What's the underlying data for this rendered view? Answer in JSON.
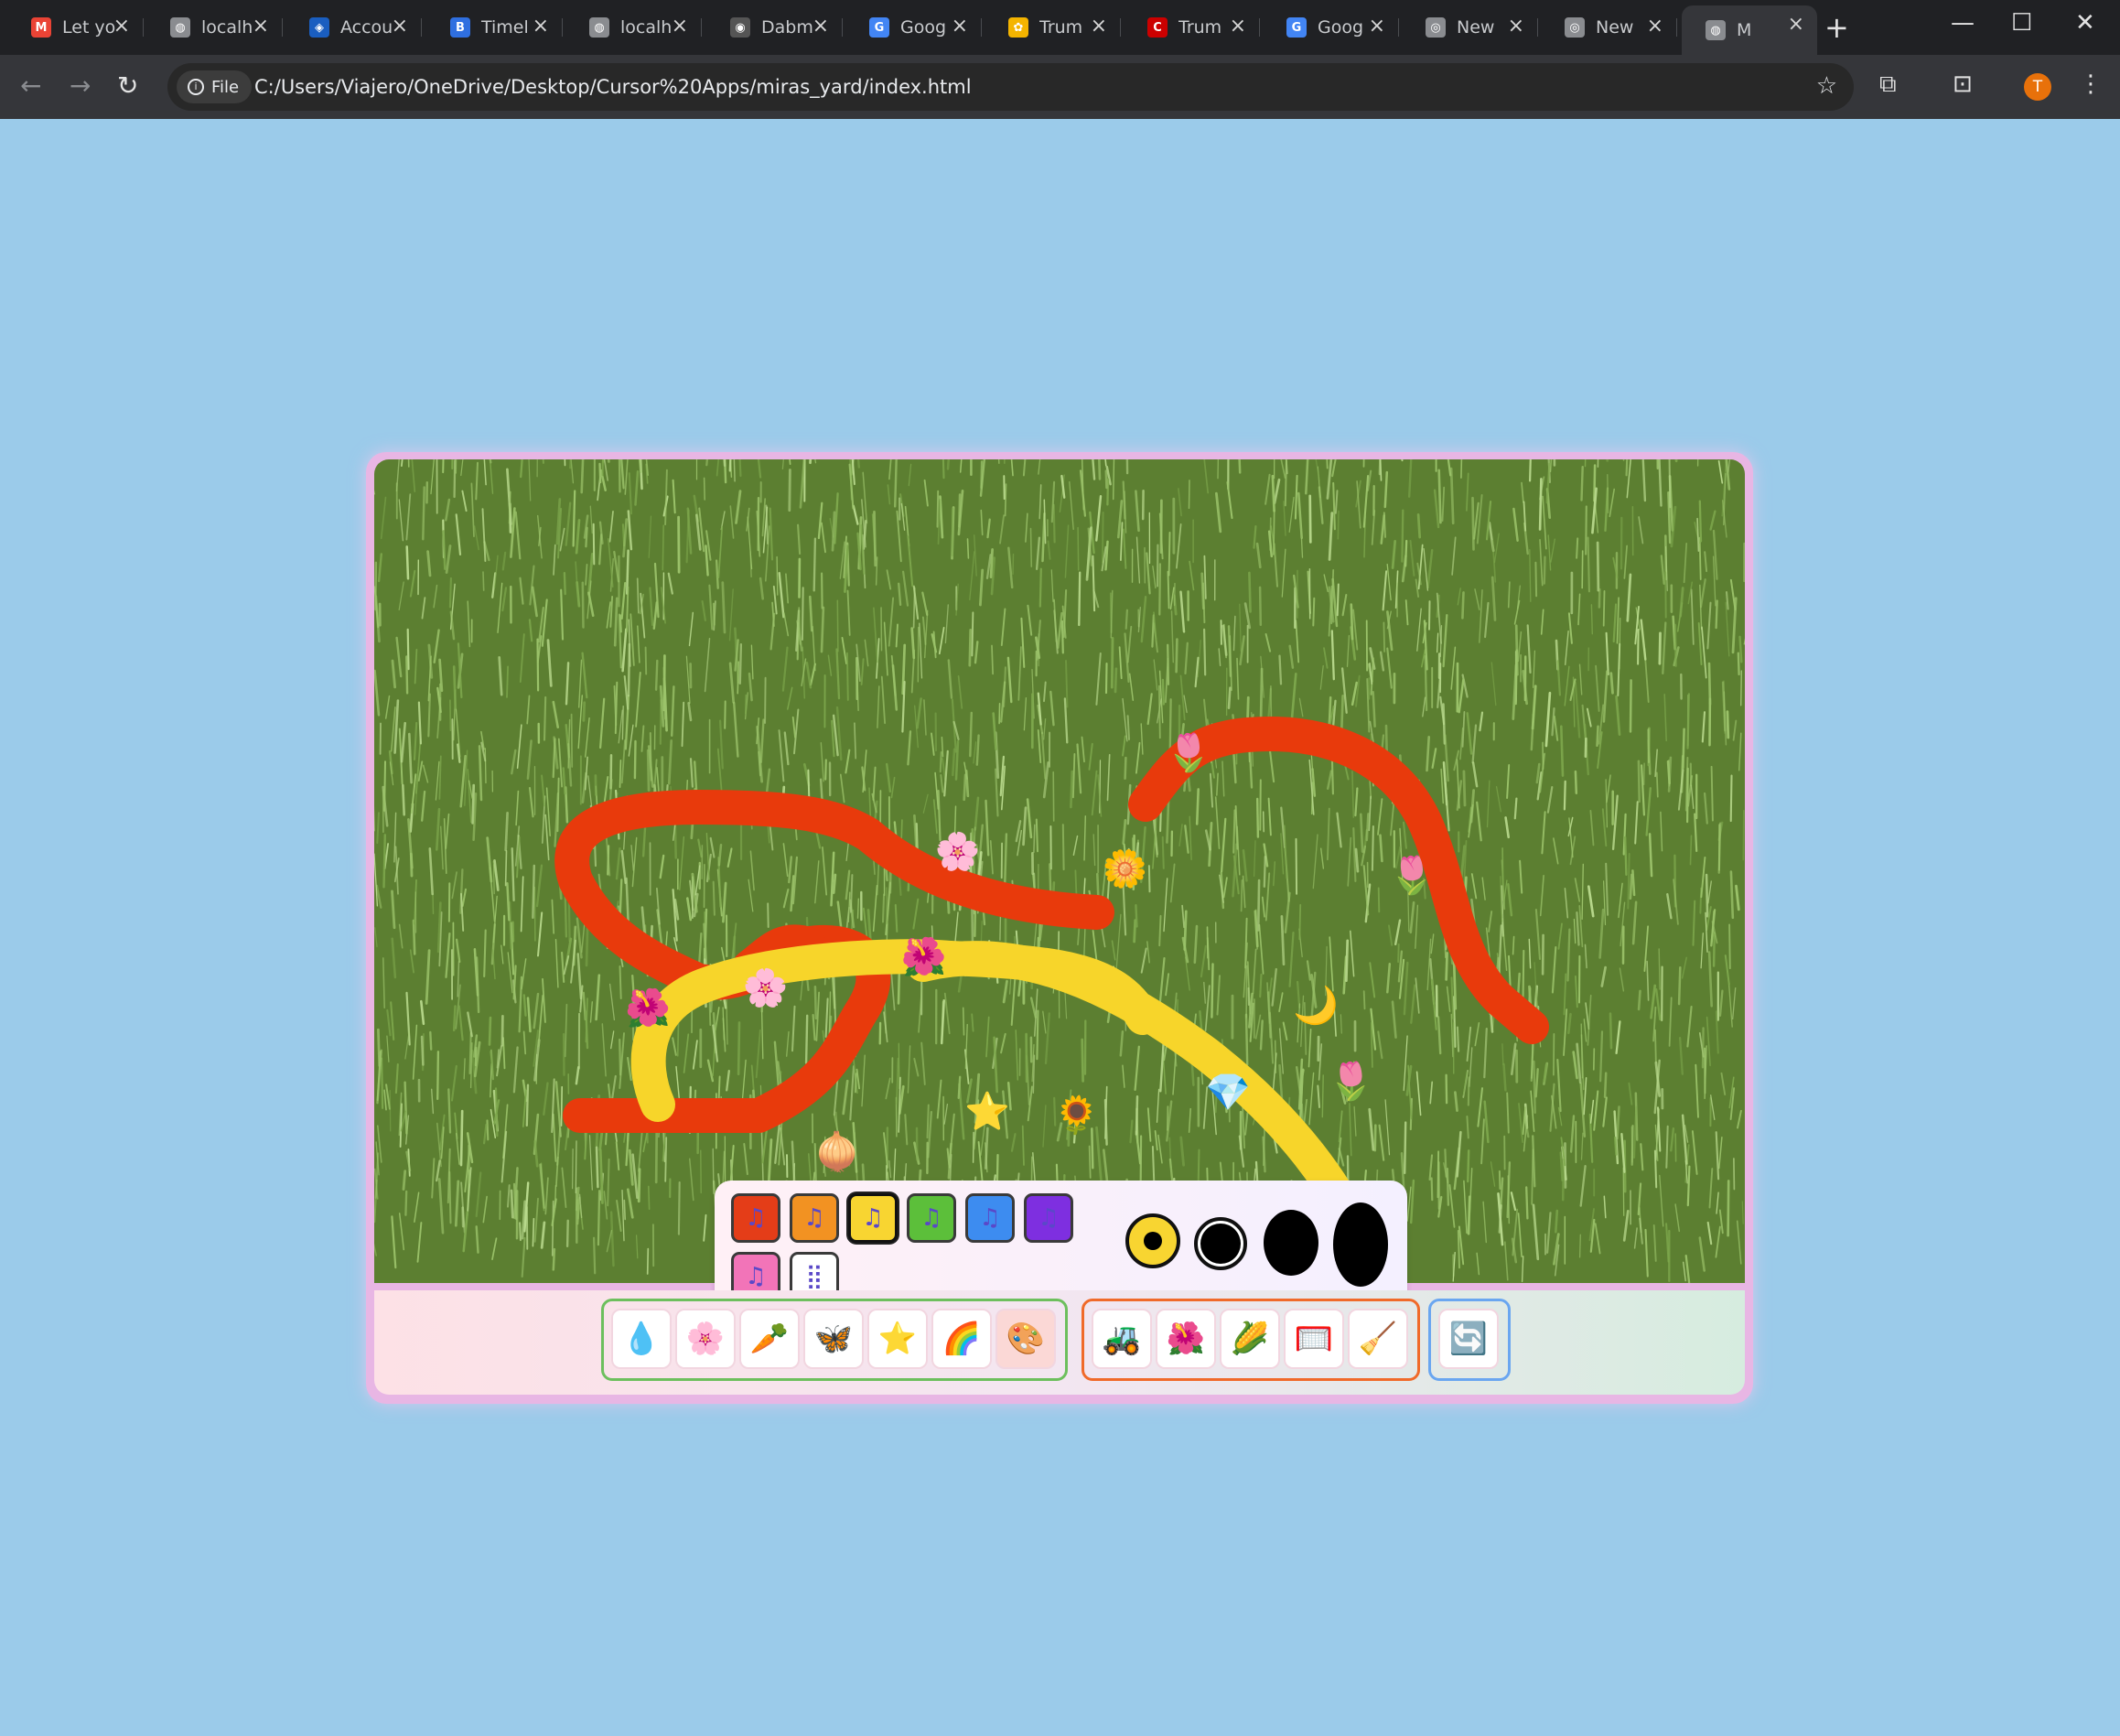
{
  "browser": {
    "tabs": [
      {
        "title": "Let yo",
        "icon": "gmail-icon",
        "color": "#ea4335",
        "glyph": "M"
      },
      {
        "title": "localh",
        "icon": "globe-icon",
        "color": "#8a8c90",
        "glyph": "◍"
      },
      {
        "title": "Accou",
        "icon": "chase-icon",
        "color": "#1a5ec0",
        "glyph": "◈"
      },
      {
        "title": "Timel",
        "icon": "bookmark-b-icon",
        "color": "#2f6fe0",
        "glyph": "B"
      },
      {
        "title": "localh",
        "icon": "globe-icon",
        "color": "#8a8c90",
        "glyph": "◍"
      },
      {
        "title": "Dabm",
        "icon": "site-icon",
        "color": "#555555",
        "glyph": "◉"
      },
      {
        "title": "Goog",
        "icon": "google-sheets-icon",
        "color": "#4285f4",
        "glyph": "G"
      },
      {
        "title": "Trum",
        "icon": "nbc-icon",
        "color": "#f4b400",
        "glyph": "✿"
      },
      {
        "title": "Trum",
        "icon": "cnn-icon",
        "color": "#cc0000",
        "glyph": "C"
      },
      {
        "title": "Goog",
        "icon": "google-sheets-icon",
        "color": "#4285f4",
        "glyph": "G"
      },
      {
        "title": "New",
        "icon": "chrome-icon",
        "color": "#8a8c90",
        "glyph": "◎"
      },
      {
        "title": "New",
        "icon": "chrome-icon",
        "color": "#8a8c90",
        "glyph": "◎"
      },
      {
        "title": "M",
        "icon": "globe-icon",
        "color": "#8a8c90",
        "glyph": "◍",
        "active": true
      }
    ],
    "file_chip": "File",
    "url": "C:/Users/Viajero/OneDrive/Desktop/Cursor%20Apps/miras_yard/index.html",
    "profile_initial": "T"
  },
  "game": {
    "strokes": [
      {
        "color": "#e83a0c",
        "name": "red-upper-loop"
      },
      {
        "color": "#e83a0c",
        "name": "red-lower-loop"
      },
      {
        "color": "#e83a0c",
        "name": "red-right-arc"
      },
      {
        "color": "#f7d52a",
        "name": "yellow-inner-arc"
      },
      {
        "color": "#f7d52a",
        "name": "yellow-outer-arc"
      }
    ],
    "stickers": [
      {
        "emoji": "🌷",
        "name": "tulip-sticker"
      },
      {
        "emoji": "🌸",
        "name": "cherry-blossom-sticker"
      },
      {
        "emoji": "🌼",
        "name": "blossom-sticker"
      },
      {
        "emoji": "🌷",
        "name": "tulip-sticker"
      },
      {
        "emoji": "🌸",
        "name": "cherry-blossom-sticker"
      },
      {
        "emoji": "🌺",
        "name": "hibiscus-sticker"
      },
      {
        "emoji": "🌺",
        "name": "hibiscus-sticker"
      },
      {
        "emoji": "🌙",
        "name": "moon-sticker"
      },
      {
        "emoji": "🌷",
        "name": "tulip-sticker"
      },
      {
        "emoji": "💎",
        "name": "gem-sticker"
      },
      {
        "emoji": "⭐",
        "name": "star-sticker"
      },
      {
        "emoji": "🌻",
        "name": "sunflower-sticker"
      },
      {
        "emoji": "🧅",
        "name": "onion-sticker"
      }
    ],
    "palette": {
      "colors": [
        {
          "hex": "#e43d18",
          "name": "red"
        },
        {
          "hex": "#f29222",
          "name": "orange"
        },
        {
          "hex": "#f8d531",
          "name": "yellow",
          "selected": true
        },
        {
          "hex": "#5cbf3a",
          "name": "green"
        },
        {
          "hex": "#3d8cf0",
          "name": "blue"
        },
        {
          "hex": "#7e2fe0",
          "name": "purple"
        },
        {
          "hex": "#f274b8",
          "name": "pink"
        },
        {
          "hex": "#ffffff",
          "name": "rainbow"
        }
      ],
      "note_glyph": "♫",
      "rainbow_glyph": "⣿",
      "brush_sizes": [
        "small",
        "medium",
        "large",
        "extra-large"
      ],
      "selected_brush": "small"
    },
    "tool_groups": [
      {
        "color": "#6dbf5d",
        "tools": [
          {
            "emoji": "💧",
            "name": "water-tool"
          },
          {
            "emoji": "🌸",
            "name": "flower-tool"
          },
          {
            "emoji": "🥕",
            "name": "carrot-tool"
          },
          {
            "emoji": "🦋",
            "name": "butterfly-tool"
          },
          {
            "emoji": "⭐",
            "name": "star-tool"
          },
          {
            "emoji": "🌈",
            "name": "rainbow-tool"
          },
          {
            "emoji": "🎨",
            "name": "paint-tool",
            "selected": true
          }
        ]
      },
      {
        "color": "#f06a2a",
        "tools": [
          {
            "emoji": "🚜",
            "name": "mower-tool"
          },
          {
            "emoji": "🌺",
            "name": "plant-tool"
          },
          {
            "emoji": "🌽",
            "name": "corn-tool"
          },
          {
            "emoji": "🥅",
            "name": "goal-tool"
          },
          {
            "emoji": "🧹",
            "name": "broom-tool"
          }
        ]
      },
      {
        "color": "#6aa6f0",
        "tools": [
          {
            "emoji": "🔄",
            "name": "reset-tool"
          }
        ]
      }
    ]
  }
}
